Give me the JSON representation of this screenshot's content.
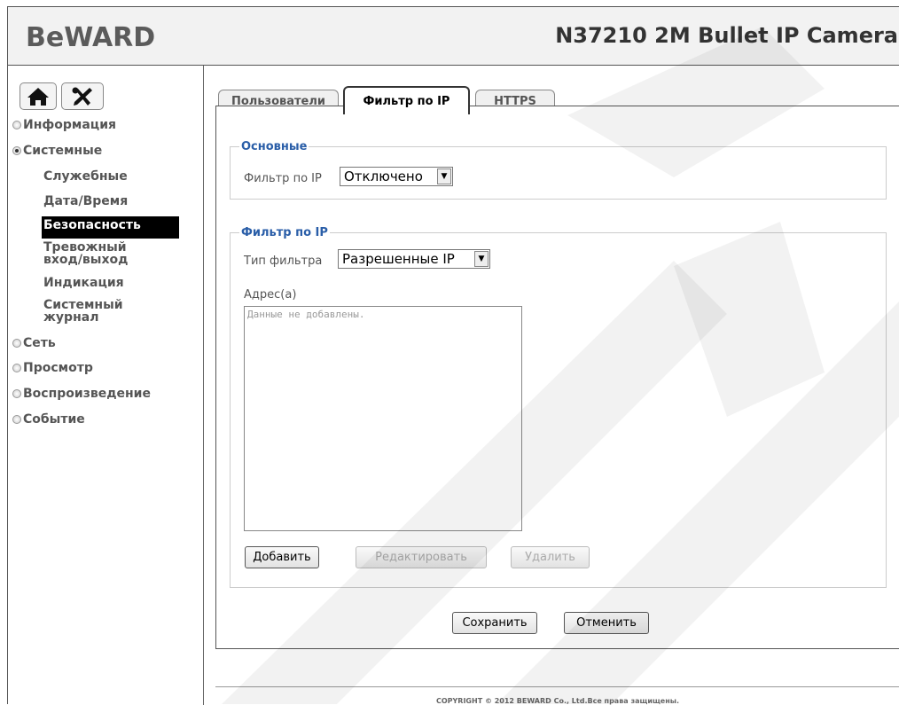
{
  "header": {
    "logo": "BeWARD",
    "camera_title": "N37210 2M Bullet IP Camera"
  },
  "sidebar": {
    "items": [
      {
        "label": "Информация",
        "expanded": false
      },
      {
        "label": "Системные",
        "expanded": true
      },
      {
        "label": "Сеть",
        "expanded": false
      },
      {
        "label": "Просмотр",
        "expanded": false
      },
      {
        "label": "Воспроизведение",
        "expanded": false
      },
      {
        "label": "Событие",
        "expanded": false
      }
    ],
    "subitems": [
      {
        "label": "Служебные"
      },
      {
        "label": "Дата/Время"
      },
      {
        "label": "Безопасность",
        "active": true
      },
      {
        "label": "Тревожный вход/выход"
      },
      {
        "label": "Индикация"
      },
      {
        "label": "Системный журнал"
      }
    ]
  },
  "tabs": [
    {
      "label": "Пользователи",
      "active": false
    },
    {
      "label": "Фильтр по IP",
      "active": true
    },
    {
      "label": "HTTPS",
      "active": false
    }
  ],
  "basic": {
    "legend": "Основные",
    "filter_label": "Фильтр по IP",
    "filter_value": "Отключено"
  },
  "ipfilter": {
    "legend": "Фильтр по IP",
    "type_label": "Тип фильтра",
    "type_value": "Разрешенные IP",
    "address_label": "Адрес(а)",
    "address_empty": "Данные не добавлены.",
    "add_btn": "Добавить",
    "edit_btn": "Редактировать",
    "delete_btn": "Удалить"
  },
  "actions": {
    "save": "Сохранить",
    "cancel": "Отменить"
  },
  "footer": {
    "copyright": "COPYRIGHT © 2012 BEWARD Co., Ltd.Все права защищены."
  },
  "colors": {
    "legend": "#2a5ea8",
    "active_nav_bg": "#000000"
  }
}
